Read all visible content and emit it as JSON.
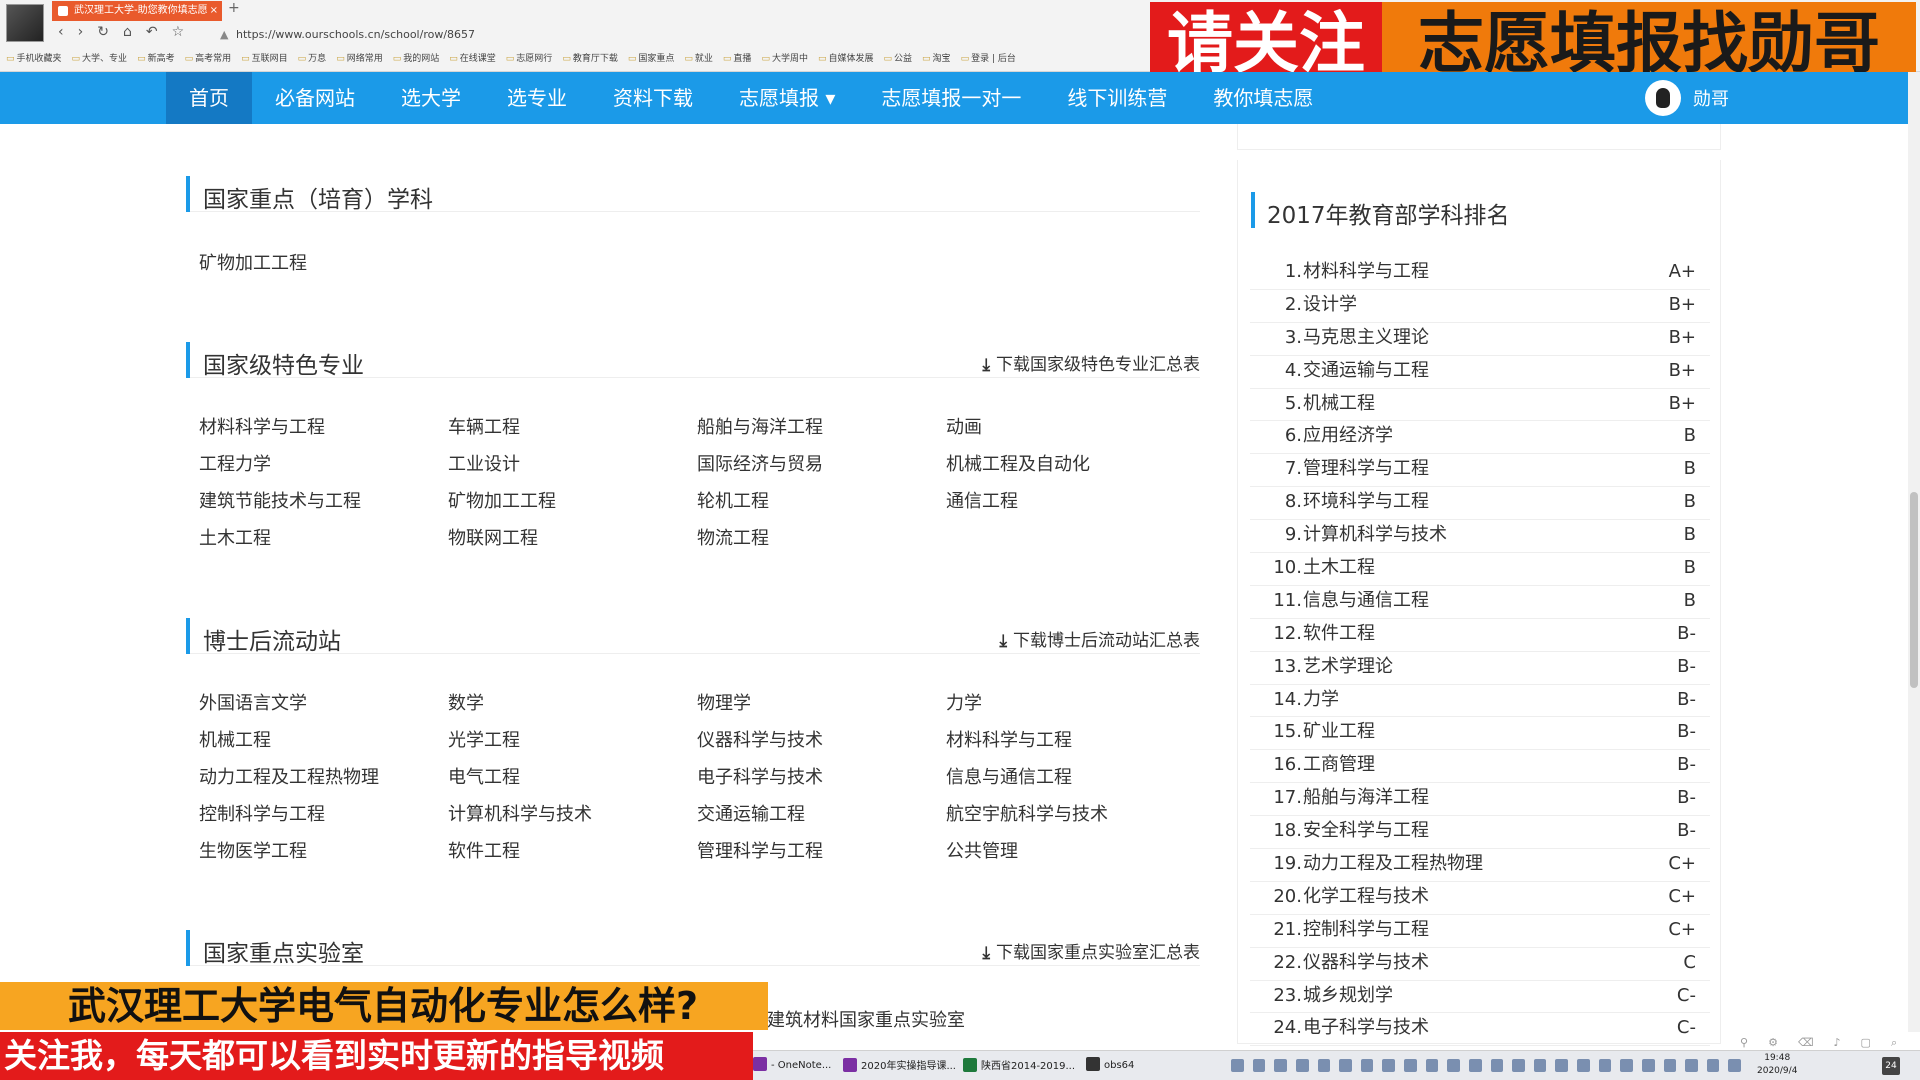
{
  "browser": {
    "tab_title": "武汉理工大学-助您教你填志愿",
    "tab_close": "×",
    "new_tab": "+",
    "nav_glyphs": [
      "‹",
      "›",
      "↻",
      "⌂",
      "↶",
      "☆"
    ],
    "url": "https://www.ourschools.cn/school/row/8657",
    "bookmarks": [
      "手机收藏夹",
      "大学、专业",
      "新高考",
      "高考常用",
      "互联网目",
      "万息",
      "网络常用",
      "我的网站",
      "在线课堂",
      "志愿网行",
      "教育厅下载",
      "国家重点",
      "就业",
      "直播",
      "大学周中",
      "自媒体发展",
      "公益",
      "淘宝",
      "登录 | 后台"
    ]
  },
  "promo": {
    "left": "请关注",
    "right": "志愿填报找勋哥"
  },
  "sitenav": {
    "items": [
      "首页",
      "必备网站",
      "选大学",
      "选专业",
      "资料下载",
      "志愿填报 ▾",
      "志愿填报一对一",
      "线下训练营",
      "教你填志愿"
    ],
    "user_name": "勋哥"
  },
  "sections": {
    "key_disciplines": {
      "title": "国家重点（培育）学科",
      "items": [
        "矿物加工工程"
      ]
    },
    "featured_majors": {
      "title": "国家级特色专业",
      "download": "下载国家级特色专业汇总表",
      "items": [
        "材料科学与工程",
        "车辆工程",
        "船舶与海洋工程",
        "动画",
        "工程力学",
        "工业设计",
        "国际经济与贸易",
        "机械工程及自动化",
        "建筑节能技术与工程",
        "矿物加工工程",
        "轮机工程",
        "通信工程",
        "土木工程",
        "物联网工程",
        "物流工程"
      ]
    },
    "postdoc": {
      "title": "博士后流动站",
      "download": "下载博士后流动站汇总表",
      "items": [
        "外国语言文学",
        "数学",
        "物理学",
        "力学",
        "机械工程",
        "光学工程",
        "仪器科学与技术",
        "材料科学与工程",
        "动力工程及工程热物理",
        "电气工程",
        "电子科学与技术",
        "信息与通信工程",
        "控制科学与工程",
        "计算机科学与技术",
        "交通运输工程",
        "航空宇航科学与技术",
        "生物医学工程",
        "软件工程",
        "管理科学与工程",
        "公共管理"
      ]
    },
    "key_labs": {
      "title": "国家重点实验室",
      "download": "下载国家重点实验室汇总表",
      "partial_item": "建筑材料国家重点实验室"
    }
  },
  "ranking": {
    "title": "2017年教育部学科排名",
    "rows": [
      {
        "num": "1.",
        "name": "材料科学与工程",
        "grade": "A+"
      },
      {
        "num": "2.",
        "name": "设计学",
        "grade": "B+"
      },
      {
        "num": "3.",
        "name": "马克思主义理论",
        "grade": "B+"
      },
      {
        "num": "4.",
        "name": "交通运输与工程",
        "grade": "B+"
      },
      {
        "num": "5.",
        "name": "机械工程",
        "grade": "B+"
      },
      {
        "num": "6.",
        "name": "应用经济学",
        "grade": "B"
      },
      {
        "num": "7.",
        "name": "管理科学与工程",
        "grade": "B"
      },
      {
        "num": "8.",
        "name": "环境科学与工程",
        "grade": "B"
      },
      {
        "num": "9.",
        "name": "计算机科学与技术",
        "grade": "B"
      },
      {
        "num": "10.",
        "name": "土木工程",
        "grade": "B"
      },
      {
        "num": "11.",
        "name": "信息与通信工程",
        "grade": "B"
      },
      {
        "num": "12.",
        "name": "软件工程",
        "grade": "B-"
      },
      {
        "num": "13.",
        "name": "艺术学理论",
        "grade": "B-"
      },
      {
        "num": "14.",
        "name": "力学",
        "grade": "B-"
      },
      {
        "num": "15.",
        "name": "矿业工程",
        "grade": "B-"
      },
      {
        "num": "16.",
        "name": "工商管理",
        "grade": "B-"
      },
      {
        "num": "17.",
        "name": "船舶与海洋工程",
        "grade": "B-"
      },
      {
        "num": "18.",
        "name": "安全科学与工程",
        "grade": "B-"
      },
      {
        "num": "19.",
        "name": "动力工程及工程热物理",
        "grade": "C+"
      },
      {
        "num": "20.",
        "name": "化学工程与技术",
        "grade": "C+"
      },
      {
        "num": "21.",
        "name": "控制科学与工程",
        "grade": "C+"
      },
      {
        "num": "22.",
        "name": "仪器科学与技术",
        "grade": "C"
      },
      {
        "num": "23.",
        "name": "城乡规划学",
        "grade": "C-"
      },
      {
        "num": "24.",
        "name": "电子科学与技术",
        "grade": "C-"
      }
    ]
  },
  "captions": {
    "line1": "武汉理工大学电气自动化专业怎么样?",
    "line2": "关注我，每天都可以看到实时更新的指导视频"
  },
  "taskbar": {
    "tasks": [
      {
        "label": "- OneNote...",
        "color": "#7b2fa3"
      },
      {
        "label": "2020年实操指导课...",
        "color": "#7b2fa3"
      },
      {
        "label": "陕西省2014-2019...",
        "color": "#1e7a3c"
      },
      {
        "label": "obs64",
        "color": "#333333"
      }
    ],
    "time": "19:48",
    "date": "2020/9/4",
    "notif": "24"
  }
}
